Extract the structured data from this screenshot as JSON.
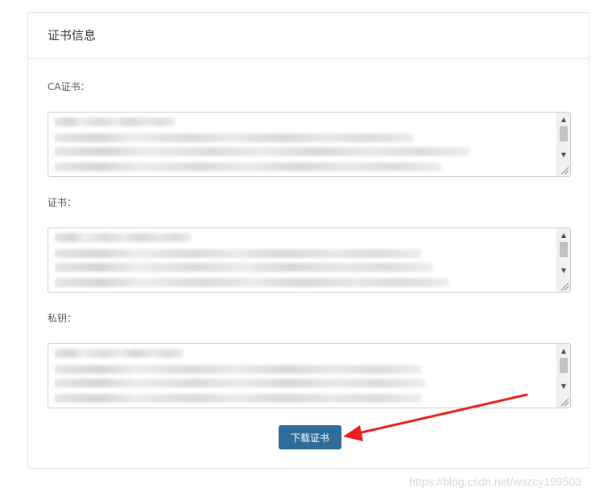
{
  "panel": {
    "title": "证书信息"
  },
  "fields": [
    {
      "label": "CA证书："
    },
    {
      "label": "证书："
    },
    {
      "label": "私钥："
    }
  ],
  "scrollbar": {
    "up_arrow": "▲",
    "down_arrow": "▼"
  },
  "actions": {
    "download_label": "下载证书"
  },
  "annotation": {
    "arrow_color": "#e8201c"
  },
  "watermark": {
    "text": "https://blog.csdn.net/wszcy199503"
  },
  "colors": {
    "button_bg": "#2e6d99",
    "border": "#e3e3e3"
  }
}
